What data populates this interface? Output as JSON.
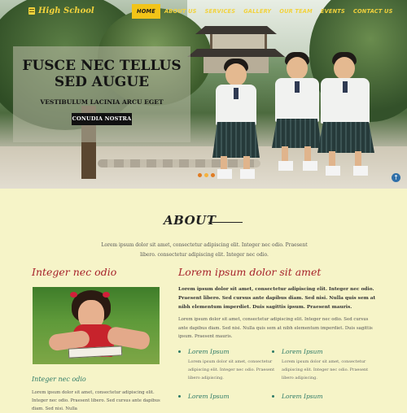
{
  "nav": {
    "logo_text": "High School",
    "items": [
      {
        "label": "HOME",
        "active": true
      },
      {
        "label": "ABOUT US"
      },
      {
        "label": "SERVICES"
      },
      {
        "label": "GALLERY"
      },
      {
        "label": "OUR TEAM"
      },
      {
        "label": "EVENTS"
      },
      {
        "label": "CONTACT US"
      }
    ]
  },
  "hero": {
    "title_line1": "FUSCE NEC TELLUS",
    "title_line2": "SED AUGUE",
    "subtitle": "VESTIBULUM LACINIA ARCU EGET",
    "button_label": "CONUDIA NOSTRA"
  },
  "about": {
    "title": "ABOUT",
    "text": "Lorem ipsum dolor sit amet, consectetur adipiscing elit. Integer nec odio. Praesent libero. consectetur adipiscing elit. Integer nec odio."
  },
  "left": {
    "heading": "Integer nec odio",
    "subheading": "Integer nec odio",
    "text": "Lorem ipsum dolor sit amet, consectetur adipiscing elit. Integer nec odio. Praesent libero. Sed cursus ante dapibus diam. Sed nisi. Nulla"
  },
  "right": {
    "heading": "Lorem ipsum dolor sit amet",
    "bold_text": "Lorem ipsum dolor sit amet, consectetur adipiscing elit. Integer nec odio. Praesent libero. Sed cursus ante dapibus diam. Sed nisi. Nulla quis sem at nibh elementum imperdiet. Duis sagittis ipsum. Praesent mauris.",
    "text": "Lorem ipsum dolor sit amet, consectetur adipiscing elit. Integer nec odio. Sed cursus ante dapibus diam. Sed nisi. Nulla quis sem at nibh elementum imperdiet. Duis sagittis ipsum. Praesent mauris.",
    "features": [
      {
        "title": "Lorem Ipsum",
        "text": "Lorem ipsum dolor sit amet, consectetur adipiscing elit. Integer nec odio. Praesent libero adipiscing."
      },
      {
        "title": "Lorem Ipsum",
        "text": "Lorem ipsum dolor sit amet, consectetur adipiscing elit. Integer nec odio. Praesent libero adipiscing."
      },
      {
        "title": "Lorem Ipsum",
        "text": ""
      },
      {
        "title": "Lorem Ipsum",
        "text": ""
      }
    ]
  },
  "colors": {
    "accent_yellow": "#f2c418",
    "heading_red": "#a6212a",
    "teal": "#2d7a67",
    "page_bg": "#f6f4c8"
  }
}
